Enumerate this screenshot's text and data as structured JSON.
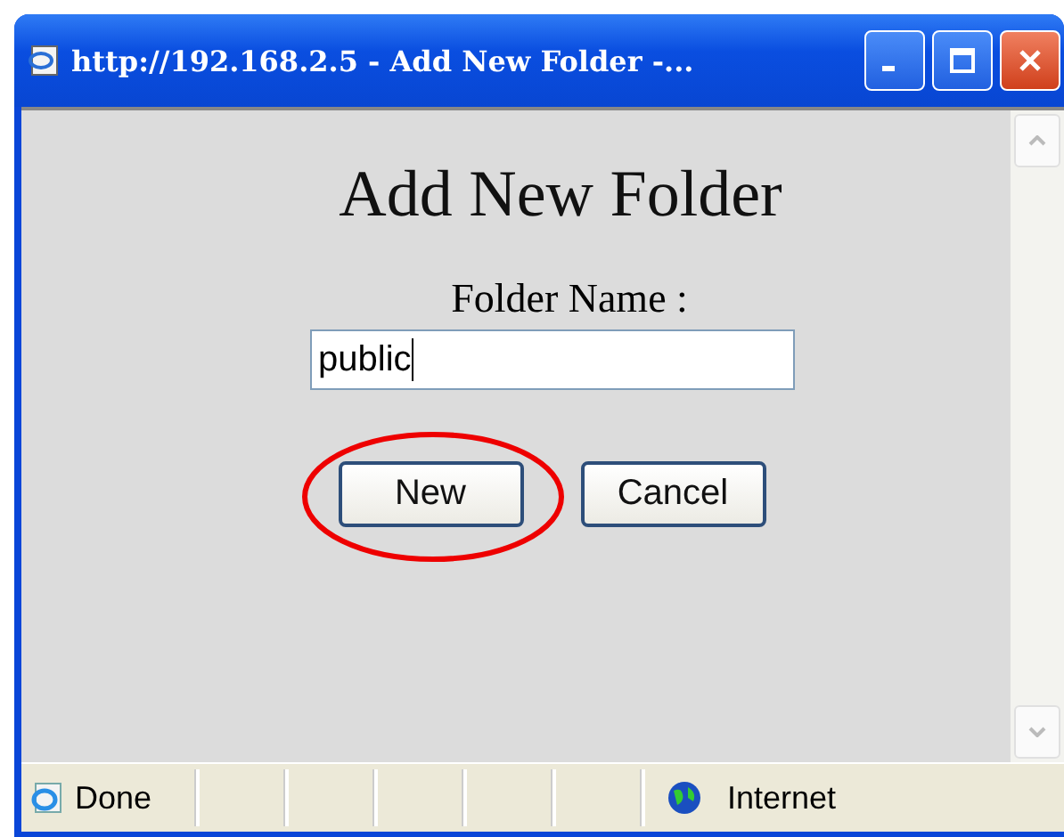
{
  "window": {
    "title": "http://192.168.2.5 - Add New Folder -..."
  },
  "heading": "Add New Folder",
  "field": {
    "label": "Folder Name :",
    "value": "public",
    "focused": true
  },
  "buttons": [
    {
      "label": "New",
      "circled": true
    },
    {
      "label": "Cancel",
      "circled": false
    }
  ],
  "status_bar": {
    "status": "Done",
    "zone": "Internet"
  }
}
